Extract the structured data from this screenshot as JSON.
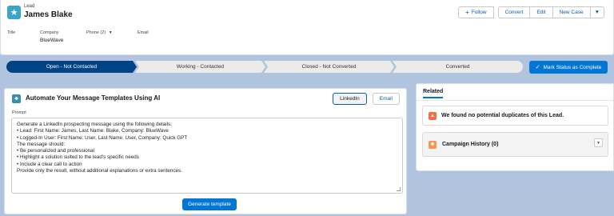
{
  "header": {
    "record_type": "Lead",
    "record_name": "James Blake",
    "buttons": {
      "follow": "Follow",
      "convert": "Convert",
      "edit": "Edit",
      "new_case": "New Case"
    },
    "fields": [
      {
        "label": "Title",
        "value": ""
      },
      {
        "label": "Company",
        "value": "BlueWave"
      },
      {
        "label": "Phone (2)",
        "value": ""
      },
      {
        "label": "Email",
        "value": ""
      }
    ]
  },
  "path": {
    "steps": [
      "Open - Not Contacted",
      "Working - Contacted",
      "Closed - Not Converted",
      "Converted"
    ],
    "active_index": 0,
    "mark_complete": "Mark Status as Complete"
  },
  "ai_card": {
    "title": "Automate Your Message Templates Using AI",
    "tabs": [
      "LinkedIn",
      "Email"
    ],
    "selected_tab": "LinkedIn",
    "prompt_label": "Prompt",
    "prompt_lines": [
      "Generate a LinkedIn prospecting message using the following details:",
      "• Lead: First Name: James, Last Name: Blake, Company: BlueWave",
      "• Logged-In User: First Name: User, Last Name: User, Company: Quick GPT",
      "",
      "The message should:",
      "• Be personalized and professional",
      "• Highlight a solution suited to the lead's specific needs",
      "• Include a clear call to action",
      "",
      "Provide only the result, without additional explanations or extra sentences."
    ],
    "generate_label": "Generate template"
  },
  "related": {
    "tab_label": "Related",
    "duplicates_text": "We found no potential duplicates of this Lead.",
    "campaign_history": "Campaign History (0)"
  },
  "colors": {
    "brand": "#0176d3",
    "path_active": "#014486",
    "background": "#b0c4df"
  },
  "icons": [
    "lead-star-icon",
    "chevron-down-icon",
    "plus-icon",
    "check-icon",
    "ai-sparkle-icon",
    "duplicate-warning-icon",
    "campaign-icon"
  ]
}
